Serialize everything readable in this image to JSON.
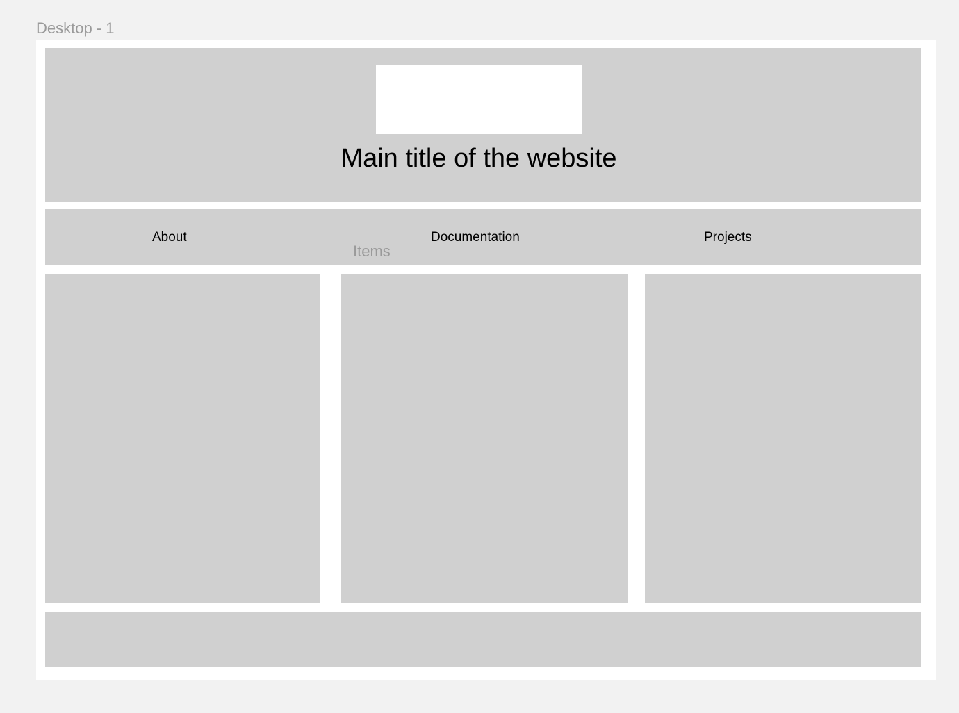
{
  "frame": {
    "label": "Desktop - 1"
  },
  "header": {
    "title": "Main title of the website"
  },
  "nav": {
    "items": [
      {
        "label": "About"
      },
      {
        "label": "Documentation"
      },
      {
        "label": "Projects"
      }
    ]
  },
  "items_section": {
    "label": "Items"
  },
  "colors": {
    "canvas": "#f2f2f2",
    "frame": "#ffffff",
    "placeholder": "#d0d0d0",
    "label": "#9a9a9a",
    "text": "#000000"
  }
}
